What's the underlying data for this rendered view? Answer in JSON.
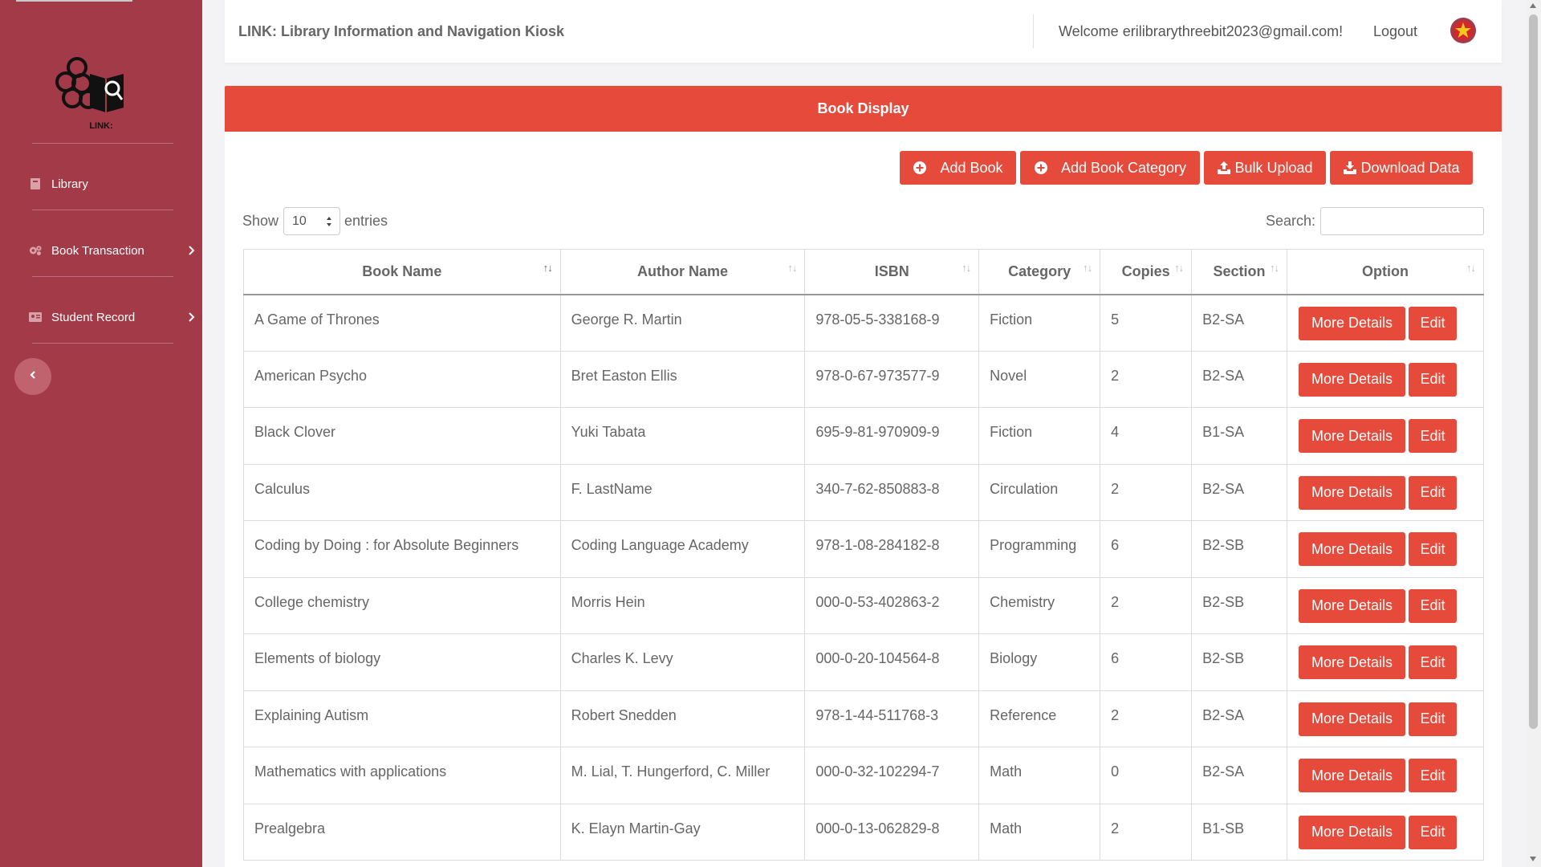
{
  "app": {
    "title": "LINK: Library Information and Navigation Kiosk",
    "welcome": "Welcome erilibrarythreebit2023@gmail.com!",
    "logout": "Logout",
    "logo_text": "LINK:"
  },
  "sidebar": {
    "items": [
      {
        "label": "Library",
        "icon": "book-icon"
      },
      {
        "label": "Book Transaction",
        "icon": "gears-icon"
      },
      {
        "label": "Student Record",
        "icon": "id-card-icon"
      }
    ]
  },
  "panel": {
    "title": "Book Display",
    "buttons": {
      "add_book": "Add Book",
      "add_category": "Add Book Category",
      "bulk_upload": "Bulk Upload",
      "download": "Download Data"
    },
    "show_label": "Show",
    "entries_value": "10",
    "entries_label": "entries",
    "search_label": "Search:",
    "search_value": ""
  },
  "table": {
    "headers": [
      "Book Name",
      "Author Name",
      "ISBN",
      "Category",
      "Copies",
      "Section",
      "Option"
    ],
    "rows": [
      [
        "A Game of Thrones",
        "George R. Martin",
        "978-05-5-338168-9",
        "Fiction",
        "5",
        "B2-SA"
      ],
      [
        "American Psycho",
        "Bret Easton Ellis",
        "978-0-67-973577-9",
        "Novel",
        "2",
        "B2-SA"
      ],
      [
        "Black Clover",
        "Yuki Tabata",
        "695-9-81-970909-9",
        "Fiction",
        "4",
        "B1-SA"
      ],
      [
        "Calculus",
        "F. LastName",
        "340-7-62-850883-8",
        "Circulation",
        "2",
        "B2-SA"
      ],
      [
        "Coding by Doing : for Absolute Beginners",
        "Coding Language Academy",
        "978-1-08-284182-8",
        "Programming",
        "6",
        "B2-SB"
      ],
      [
        "College chemistry",
        "Morris Hein",
        "000-0-53-402863-2",
        "Chemistry",
        "2",
        "B2-SB"
      ],
      [
        "Elements of biology",
        "Charles K. Levy",
        "000-0-20-104564-8",
        "Biology",
        "6",
        "B2-SB"
      ],
      [
        "Explaining Autism",
        "Robert Snedden",
        "978-1-44-511768-3",
        "Reference",
        "2",
        "B2-SA"
      ],
      [
        "Mathematics with applications",
        "M. Lial, T. Hungerford, C. Miller",
        "000-0-32-102294-7",
        "Math",
        "0",
        "B2-SA"
      ],
      [
        "Prealgebra",
        "K. Elayn Martin-Gay",
        "000-0-13-062829-8",
        "Math",
        "2",
        "B1-SB"
      ]
    ],
    "row_buttons": {
      "more": "More Details",
      "edit": "Edit"
    }
  },
  "colors": {
    "sidebar": "#a33a47",
    "accent": "#e64a3b",
    "collapse_button": "#c1636e"
  }
}
